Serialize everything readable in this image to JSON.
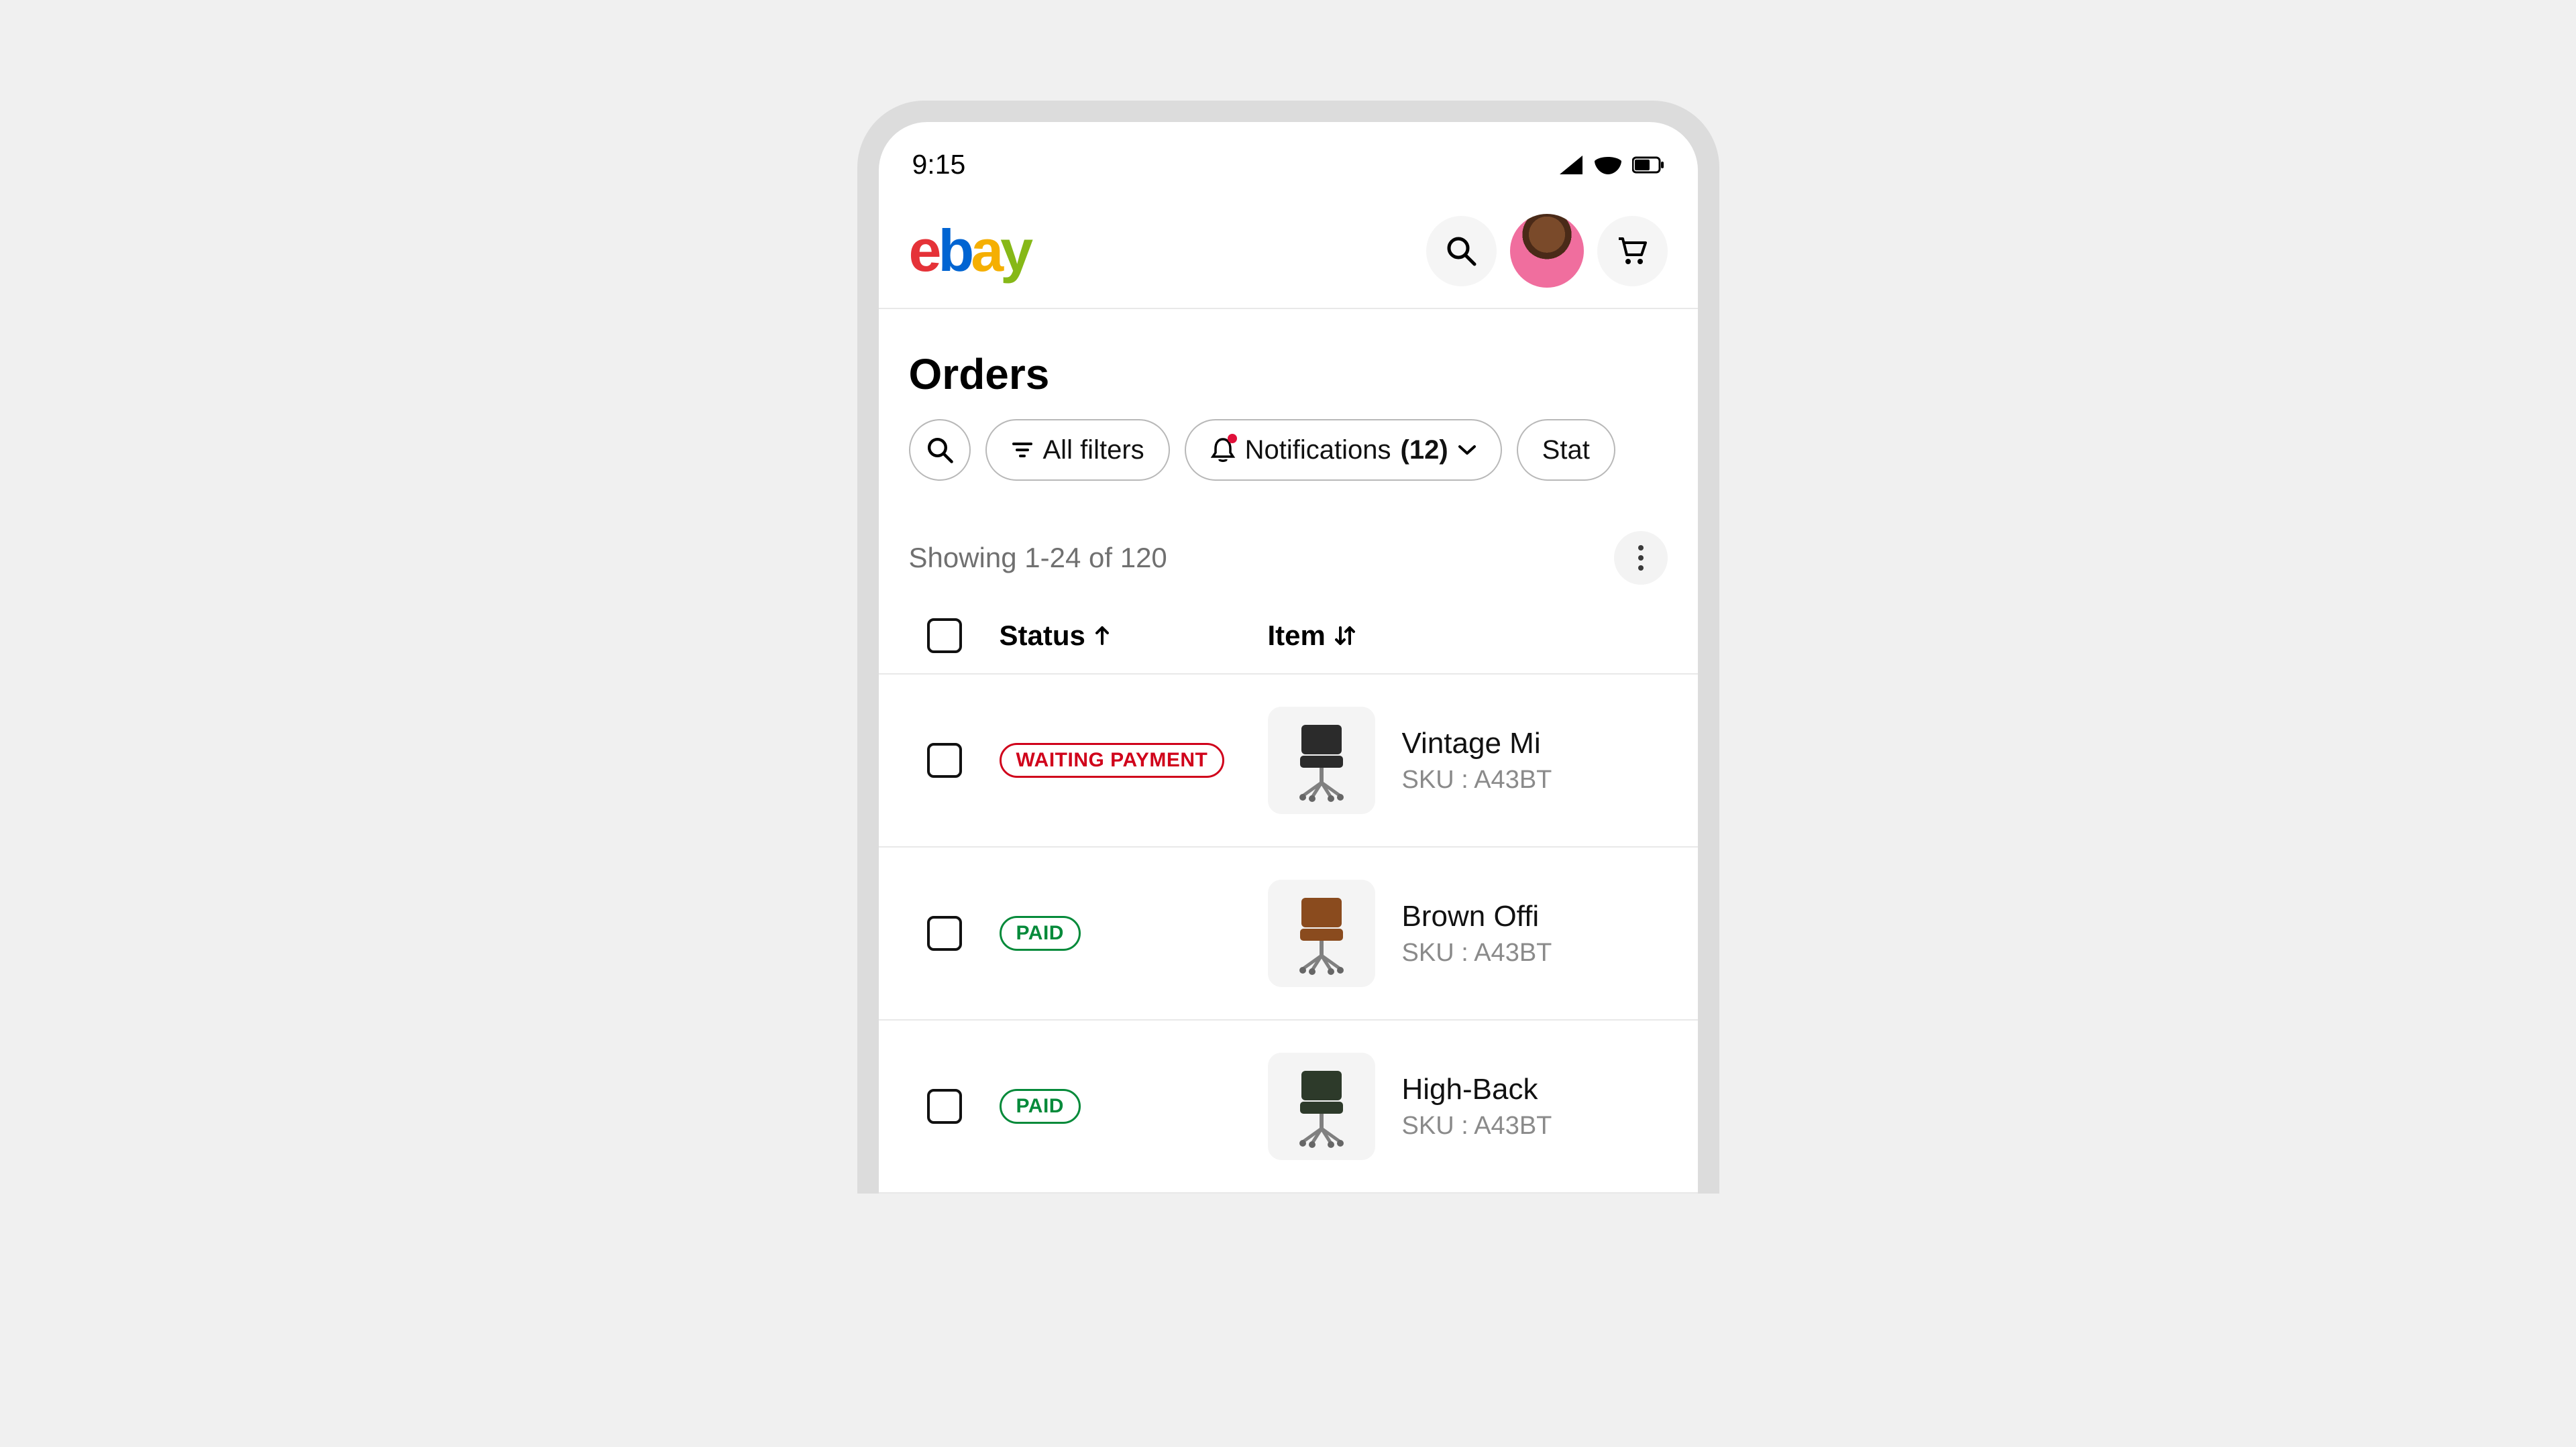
{
  "status_bar": {
    "time": "9:15"
  },
  "page": {
    "title": "Orders"
  },
  "filters": {
    "all_filters": "All filters",
    "notifications_label": "Notifications",
    "notifications_count": "(12)",
    "status_partial": "Stat"
  },
  "results": {
    "text": "Showing 1-24 of 120"
  },
  "columns": {
    "status": "Status",
    "item": "Item"
  },
  "rows": [
    {
      "status": "WAITING PAYMENT",
      "status_kind": "waiting",
      "name": "Vintage Mi",
      "sku": "SKU : A43BT",
      "thumb_color": "#2b2b2b"
    },
    {
      "status": "PAID",
      "status_kind": "paid",
      "name": "Brown Offi",
      "sku": "SKU : A43BT",
      "thumb_color": "#8a4b1e"
    },
    {
      "status": "PAID",
      "status_kind": "paid",
      "name": "High-Back",
      "sku": "SKU : A43BT",
      "thumb_color": "#2d3a2a"
    }
  ]
}
